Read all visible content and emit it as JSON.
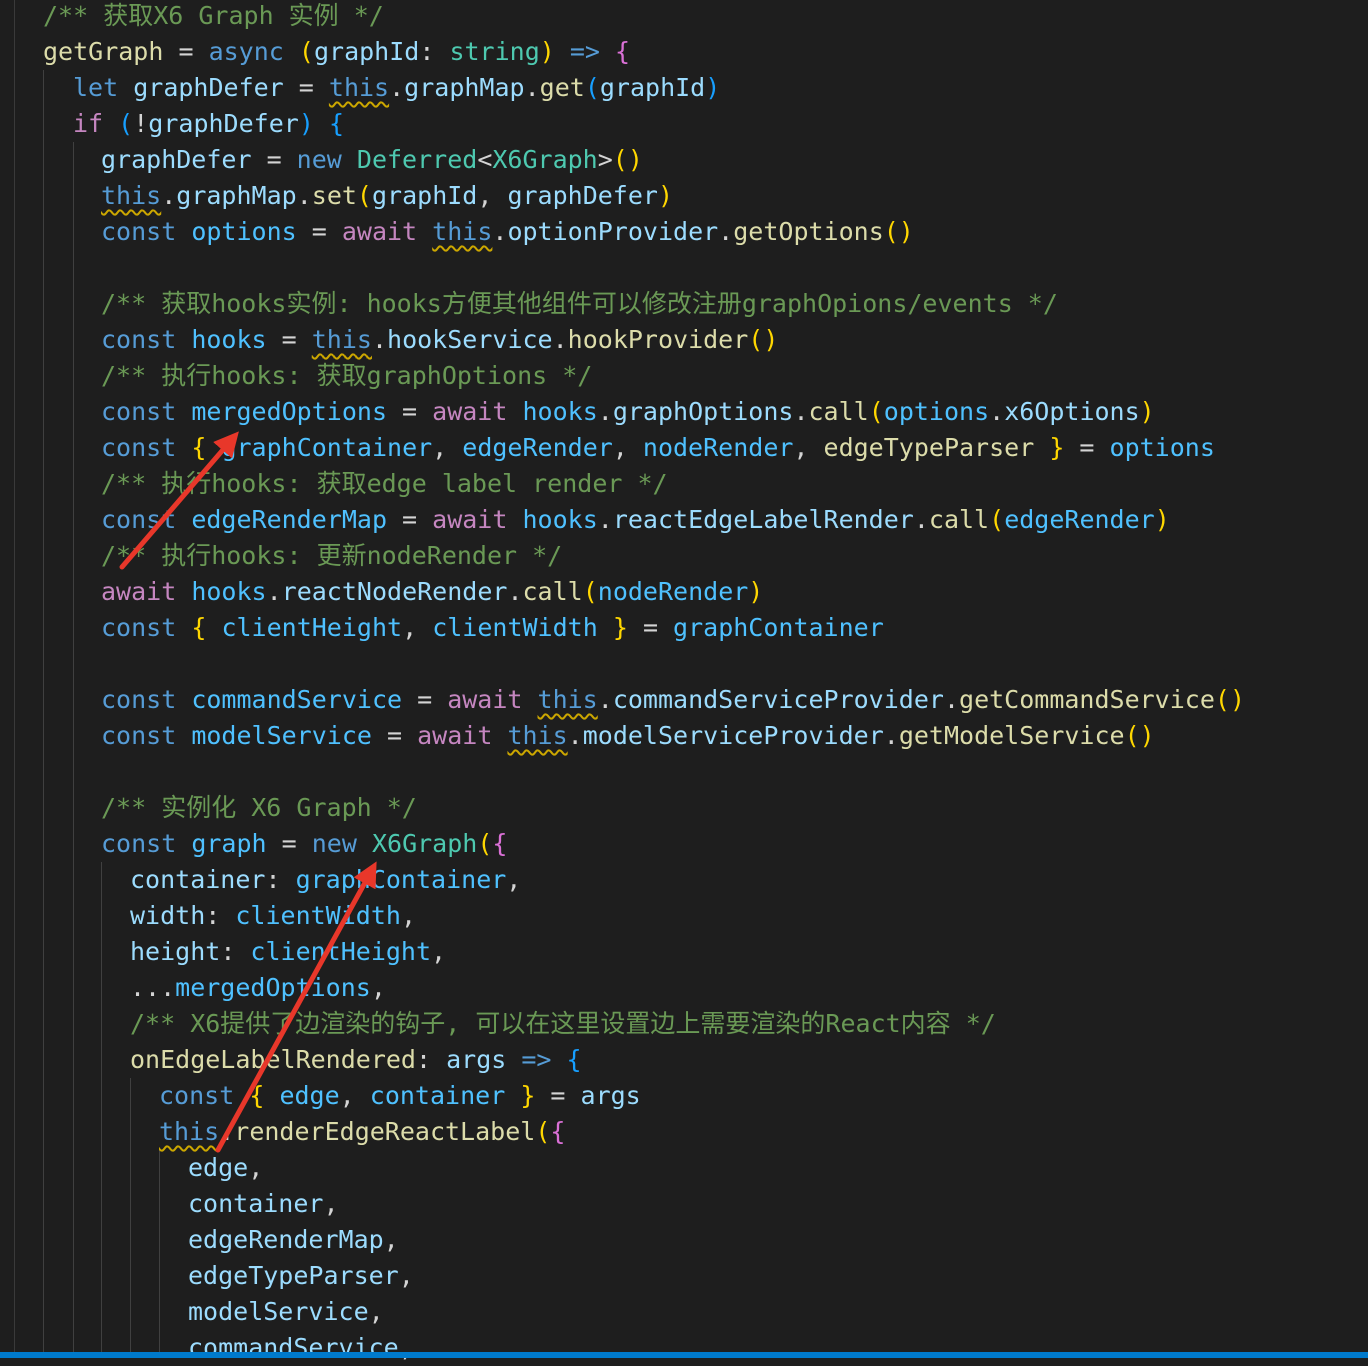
{
  "editor": {
    "colors": {
      "background": "#1e1e1e",
      "annotation_arrow": "#e8372a",
      "status_bar": "#007acc"
    },
    "lines": [
      {
        "tokens": [
          {
            "t": "/** 获取X6 Graph 实例 */",
            "c": "cm"
          }
        ]
      },
      {
        "tokens": [
          {
            "t": "getGraph",
            "c": "fn"
          },
          {
            "t": " = ",
            "c": "punc"
          },
          {
            "t": "async",
            "c": "kw"
          },
          {
            "t": " ",
            "c": "punc"
          },
          {
            "t": "(",
            "c": "br1"
          },
          {
            "t": "graphId",
            "c": "var"
          },
          {
            "t": ": ",
            "c": "punc"
          },
          {
            "t": "string",
            "c": "type"
          },
          {
            "t": ")",
            "c": "br1"
          },
          {
            "t": " ",
            "c": "punc"
          },
          {
            "t": "=>",
            "c": "kw"
          },
          {
            "t": " ",
            "c": "punc"
          },
          {
            "t": "{",
            "c": "br2"
          }
        ]
      },
      {
        "tokens": [
          {
            "t": "let",
            "c": "kw"
          },
          {
            "t": " ",
            "c": "punc"
          },
          {
            "t": "graphDefer",
            "c": "var"
          },
          {
            "t": " = ",
            "c": "punc"
          },
          {
            "t": "this",
            "c": "kw squig"
          },
          {
            "t": ".",
            "c": "punc"
          },
          {
            "t": "graphMap",
            "c": "var"
          },
          {
            "t": ".",
            "c": "punc"
          },
          {
            "t": "get",
            "c": "fn"
          },
          {
            "t": "(",
            "c": "br3"
          },
          {
            "t": "graphId",
            "c": "var"
          },
          {
            "t": ")",
            "c": "br3"
          }
        ]
      },
      {
        "tokens": [
          {
            "t": "if",
            "c": "ctl"
          },
          {
            "t": " ",
            "c": "punc"
          },
          {
            "t": "(",
            "c": "br3"
          },
          {
            "t": "!",
            "c": "punc"
          },
          {
            "t": "graphDefer",
            "c": "var"
          },
          {
            "t": ")",
            "c": "br3"
          },
          {
            "t": " ",
            "c": "punc"
          },
          {
            "t": "{",
            "c": "br3"
          }
        ]
      },
      {
        "tokens": [
          {
            "t": "graphDefer",
            "c": "var"
          },
          {
            "t": " = ",
            "c": "punc"
          },
          {
            "t": "new",
            "c": "kw"
          },
          {
            "t": " ",
            "c": "punc"
          },
          {
            "t": "Deferred",
            "c": "type"
          },
          {
            "t": "<",
            "c": "punc"
          },
          {
            "t": "X6Graph",
            "c": "type"
          },
          {
            "t": ">",
            "c": "punc"
          },
          {
            "t": "()",
            "c": "br1"
          }
        ]
      },
      {
        "tokens": [
          {
            "t": "this",
            "c": "kw squig"
          },
          {
            "t": ".",
            "c": "punc"
          },
          {
            "t": "graphMap",
            "c": "var"
          },
          {
            "t": ".",
            "c": "punc"
          },
          {
            "t": "set",
            "c": "fn"
          },
          {
            "t": "(",
            "c": "br1"
          },
          {
            "t": "graphId",
            "c": "var"
          },
          {
            "t": ", ",
            "c": "punc"
          },
          {
            "t": "graphDefer",
            "c": "var"
          },
          {
            "t": ")",
            "c": "br1"
          }
        ]
      },
      {
        "tokens": [
          {
            "t": "const",
            "c": "kw"
          },
          {
            "t": " ",
            "c": "punc"
          },
          {
            "t": "options",
            "c": "const"
          },
          {
            "t": " = ",
            "c": "punc"
          },
          {
            "t": "await",
            "c": "ctl"
          },
          {
            "t": " ",
            "c": "punc"
          },
          {
            "t": "this",
            "c": "kw squig"
          },
          {
            "t": ".",
            "c": "punc"
          },
          {
            "t": "optionProvider",
            "c": "var"
          },
          {
            "t": ".",
            "c": "punc"
          },
          {
            "t": "getOptions",
            "c": "fn"
          },
          {
            "t": "()",
            "c": "br1"
          }
        ]
      },
      {
        "tokens": []
      },
      {
        "tokens": [
          {
            "t": "/** 获取hooks实例: hooks方便其他组件可以修改注册graphOpions/events */",
            "c": "cm"
          }
        ]
      },
      {
        "tokens": [
          {
            "t": "const",
            "c": "kw"
          },
          {
            "t": " ",
            "c": "punc"
          },
          {
            "t": "hooks",
            "c": "const"
          },
          {
            "t": " = ",
            "c": "punc"
          },
          {
            "t": "this",
            "c": "kw squig"
          },
          {
            "t": ".",
            "c": "punc"
          },
          {
            "t": "hookService",
            "c": "var"
          },
          {
            "t": ".",
            "c": "punc"
          },
          {
            "t": "hookProvider",
            "c": "fn"
          },
          {
            "t": "()",
            "c": "br1"
          }
        ]
      },
      {
        "tokens": [
          {
            "t": "/** 执行hooks: 获取graphOptions */",
            "c": "cm"
          }
        ]
      },
      {
        "tokens": [
          {
            "t": "const",
            "c": "kw"
          },
          {
            "t": " ",
            "c": "punc"
          },
          {
            "t": "mergedOptions",
            "c": "const"
          },
          {
            "t": " = ",
            "c": "punc"
          },
          {
            "t": "await",
            "c": "ctl"
          },
          {
            "t": " ",
            "c": "punc"
          },
          {
            "t": "hooks",
            "c": "const"
          },
          {
            "t": ".",
            "c": "punc"
          },
          {
            "t": "graphOptions",
            "c": "var"
          },
          {
            "t": ".",
            "c": "punc"
          },
          {
            "t": "call",
            "c": "fn"
          },
          {
            "t": "(",
            "c": "br1"
          },
          {
            "t": "options",
            "c": "const"
          },
          {
            "t": ".",
            "c": "punc"
          },
          {
            "t": "x6Options",
            "c": "var"
          },
          {
            "t": ")",
            "c": "br1"
          }
        ]
      },
      {
        "tokens": [
          {
            "t": "const",
            "c": "kw"
          },
          {
            "t": " ",
            "c": "punc"
          },
          {
            "t": "{",
            "c": "br1"
          },
          {
            "t": " ",
            "c": "punc"
          },
          {
            "t": "graphContainer",
            "c": "const"
          },
          {
            "t": ", ",
            "c": "punc"
          },
          {
            "t": "edgeRender",
            "c": "const"
          },
          {
            "t": ", ",
            "c": "punc"
          },
          {
            "t": "nodeRender",
            "c": "const"
          },
          {
            "t": ", ",
            "c": "punc"
          },
          {
            "t": "edgeTypeParser",
            "c": "fn"
          },
          {
            "t": " ",
            "c": "punc"
          },
          {
            "t": "}",
            "c": "br1"
          },
          {
            "t": " = ",
            "c": "punc"
          },
          {
            "t": "options",
            "c": "const"
          }
        ]
      },
      {
        "tokens": [
          {
            "t": "/** 执行hooks: 获取edge label render */",
            "c": "cm"
          }
        ]
      },
      {
        "tokens": [
          {
            "t": "const",
            "c": "kw"
          },
          {
            "t": " ",
            "c": "punc"
          },
          {
            "t": "edgeRenderMap",
            "c": "const"
          },
          {
            "t": " = ",
            "c": "punc"
          },
          {
            "t": "await",
            "c": "ctl"
          },
          {
            "t": " ",
            "c": "punc"
          },
          {
            "t": "hooks",
            "c": "const"
          },
          {
            "t": ".",
            "c": "punc"
          },
          {
            "t": "reactEdgeLabelRender",
            "c": "var"
          },
          {
            "t": ".",
            "c": "punc"
          },
          {
            "t": "call",
            "c": "fn"
          },
          {
            "t": "(",
            "c": "br1"
          },
          {
            "t": "edgeRender",
            "c": "const"
          },
          {
            "t": ")",
            "c": "br1"
          }
        ]
      },
      {
        "tokens": [
          {
            "t": "/** 执行hooks: 更新nodeRender */",
            "c": "cm"
          }
        ]
      },
      {
        "tokens": [
          {
            "t": "await",
            "c": "ctl"
          },
          {
            "t": " ",
            "c": "punc"
          },
          {
            "t": "hooks",
            "c": "const"
          },
          {
            "t": ".",
            "c": "punc"
          },
          {
            "t": "reactNodeRender",
            "c": "var"
          },
          {
            "t": ".",
            "c": "punc"
          },
          {
            "t": "call",
            "c": "fn"
          },
          {
            "t": "(",
            "c": "br1"
          },
          {
            "t": "nodeRender",
            "c": "const"
          },
          {
            "t": ")",
            "c": "br1"
          }
        ]
      },
      {
        "tokens": [
          {
            "t": "const",
            "c": "kw"
          },
          {
            "t": " ",
            "c": "punc"
          },
          {
            "t": "{",
            "c": "br1"
          },
          {
            "t": " ",
            "c": "punc"
          },
          {
            "t": "clientHeight",
            "c": "const"
          },
          {
            "t": ", ",
            "c": "punc"
          },
          {
            "t": "clientWidth",
            "c": "const"
          },
          {
            "t": " ",
            "c": "punc"
          },
          {
            "t": "}",
            "c": "br1"
          },
          {
            "t": " = ",
            "c": "punc"
          },
          {
            "t": "graphContainer",
            "c": "const"
          }
        ]
      },
      {
        "tokens": []
      },
      {
        "tokens": [
          {
            "t": "const",
            "c": "kw"
          },
          {
            "t": " ",
            "c": "punc"
          },
          {
            "t": "commandService",
            "c": "const"
          },
          {
            "t": " = ",
            "c": "punc"
          },
          {
            "t": "await",
            "c": "ctl"
          },
          {
            "t": " ",
            "c": "punc"
          },
          {
            "t": "this",
            "c": "kw squig"
          },
          {
            "t": ".",
            "c": "punc"
          },
          {
            "t": "commandServiceProvider",
            "c": "var"
          },
          {
            "t": ".",
            "c": "punc"
          },
          {
            "t": "getCommandService",
            "c": "fn"
          },
          {
            "t": "()",
            "c": "br1"
          }
        ]
      },
      {
        "tokens": [
          {
            "t": "const",
            "c": "kw"
          },
          {
            "t": " ",
            "c": "punc"
          },
          {
            "t": "modelService",
            "c": "const"
          },
          {
            "t": " = ",
            "c": "punc"
          },
          {
            "t": "await",
            "c": "ctl"
          },
          {
            "t": " ",
            "c": "punc"
          },
          {
            "t": "this",
            "c": "kw squig"
          },
          {
            "t": ".",
            "c": "punc"
          },
          {
            "t": "modelServiceProvider",
            "c": "var"
          },
          {
            "t": ".",
            "c": "punc"
          },
          {
            "t": "getModelService",
            "c": "fn"
          },
          {
            "t": "()",
            "c": "br1"
          }
        ]
      },
      {
        "tokens": []
      },
      {
        "tokens": [
          {
            "t": "/** 实例化 X6 Graph */",
            "c": "cm"
          }
        ]
      },
      {
        "tokens": [
          {
            "t": "const",
            "c": "kw"
          },
          {
            "t": " ",
            "c": "punc"
          },
          {
            "t": "graph",
            "c": "const"
          },
          {
            "t": " = ",
            "c": "punc"
          },
          {
            "t": "new",
            "c": "kw"
          },
          {
            "t": " ",
            "c": "punc"
          },
          {
            "t": "X6Graph",
            "c": "type"
          },
          {
            "t": "(",
            "c": "br1"
          },
          {
            "t": "{",
            "c": "br2"
          }
        ]
      },
      {
        "tokens": [
          {
            "t": "container",
            "c": "var"
          },
          {
            "t": ": ",
            "c": "punc"
          },
          {
            "t": "graphContainer",
            "c": "const"
          },
          {
            "t": ",",
            "c": "punc"
          }
        ]
      },
      {
        "tokens": [
          {
            "t": "width",
            "c": "var"
          },
          {
            "t": ": ",
            "c": "punc"
          },
          {
            "t": "clientWidth",
            "c": "const"
          },
          {
            "t": ",",
            "c": "punc"
          }
        ]
      },
      {
        "tokens": [
          {
            "t": "height",
            "c": "var"
          },
          {
            "t": ": ",
            "c": "punc"
          },
          {
            "t": "clientHeight",
            "c": "const"
          },
          {
            "t": ",",
            "c": "punc"
          }
        ]
      },
      {
        "tokens": [
          {
            "t": "...",
            "c": "punc"
          },
          {
            "t": "mergedOptions",
            "c": "const"
          },
          {
            "t": ",",
            "c": "punc"
          }
        ]
      },
      {
        "tokens": [
          {
            "t": "/** X6提供了边渲染的钩子, 可以在这里设置边上需要渲染的React内容 */",
            "c": "cm"
          }
        ]
      },
      {
        "tokens": [
          {
            "t": "onEdgeLabelRendered",
            "c": "fn"
          },
          {
            "t": ": ",
            "c": "punc"
          },
          {
            "t": "args",
            "c": "var"
          },
          {
            "t": " ",
            "c": "punc"
          },
          {
            "t": "=>",
            "c": "kw"
          },
          {
            "t": " ",
            "c": "punc"
          },
          {
            "t": "{",
            "c": "br3"
          }
        ]
      },
      {
        "tokens": [
          {
            "t": "const",
            "c": "kw"
          },
          {
            "t": " ",
            "c": "punc"
          },
          {
            "t": "{",
            "c": "br1"
          },
          {
            "t": " ",
            "c": "punc"
          },
          {
            "t": "edge",
            "c": "const"
          },
          {
            "t": ", ",
            "c": "punc"
          },
          {
            "t": "container",
            "c": "const"
          },
          {
            "t": " ",
            "c": "punc"
          },
          {
            "t": "}",
            "c": "br1"
          },
          {
            "t": " = ",
            "c": "punc"
          },
          {
            "t": "args",
            "c": "var"
          }
        ]
      },
      {
        "tokens": [
          {
            "t": "this",
            "c": "kw squig"
          },
          {
            "t": ".",
            "c": "punc"
          },
          {
            "t": "renderEdgeReactLabel",
            "c": "fn"
          },
          {
            "t": "(",
            "c": "br1"
          },
          {
            "t": "{",
            "c": "br2"
          }
        ]
      },
      {
        "tokens": [
          {
            "t": "edge",
            "c": "var"
          },
          {
            "t": ",",
            "c": "punc"
          }
        ]
      },
      {
        "tokens": [
          {
            "t": "container",
            "c": "var"
          },
          {
            "t": ",",
            "c": "punc"
          }
        ]
      },
      {
        "tokens": [
          {
            "t": "edgeRenderMap",
            "c": "var"
          },
          {
            "t": ",",
            "c": "punc"
          }
        ]
      },
      {
        "tokens": [
          {
            "t": "edgeTypeParser",
            "c": "var"
          },
          {
            "t": ",",
            "c": "punc"
          }
        ]
      },
      {
        "tokens": [
          {
            "t": "modelService",
            "c": "var"
          },
          {
            "t": ",",
            "c": "punc"
          }
        ]
      },
      {
        "tokens": [
          {
            "t": "commandService",
            "c": "var"
          },
          {
            "t": ",",
            "c": "punc"
          }
        ]
      }
    ]
  }
}
